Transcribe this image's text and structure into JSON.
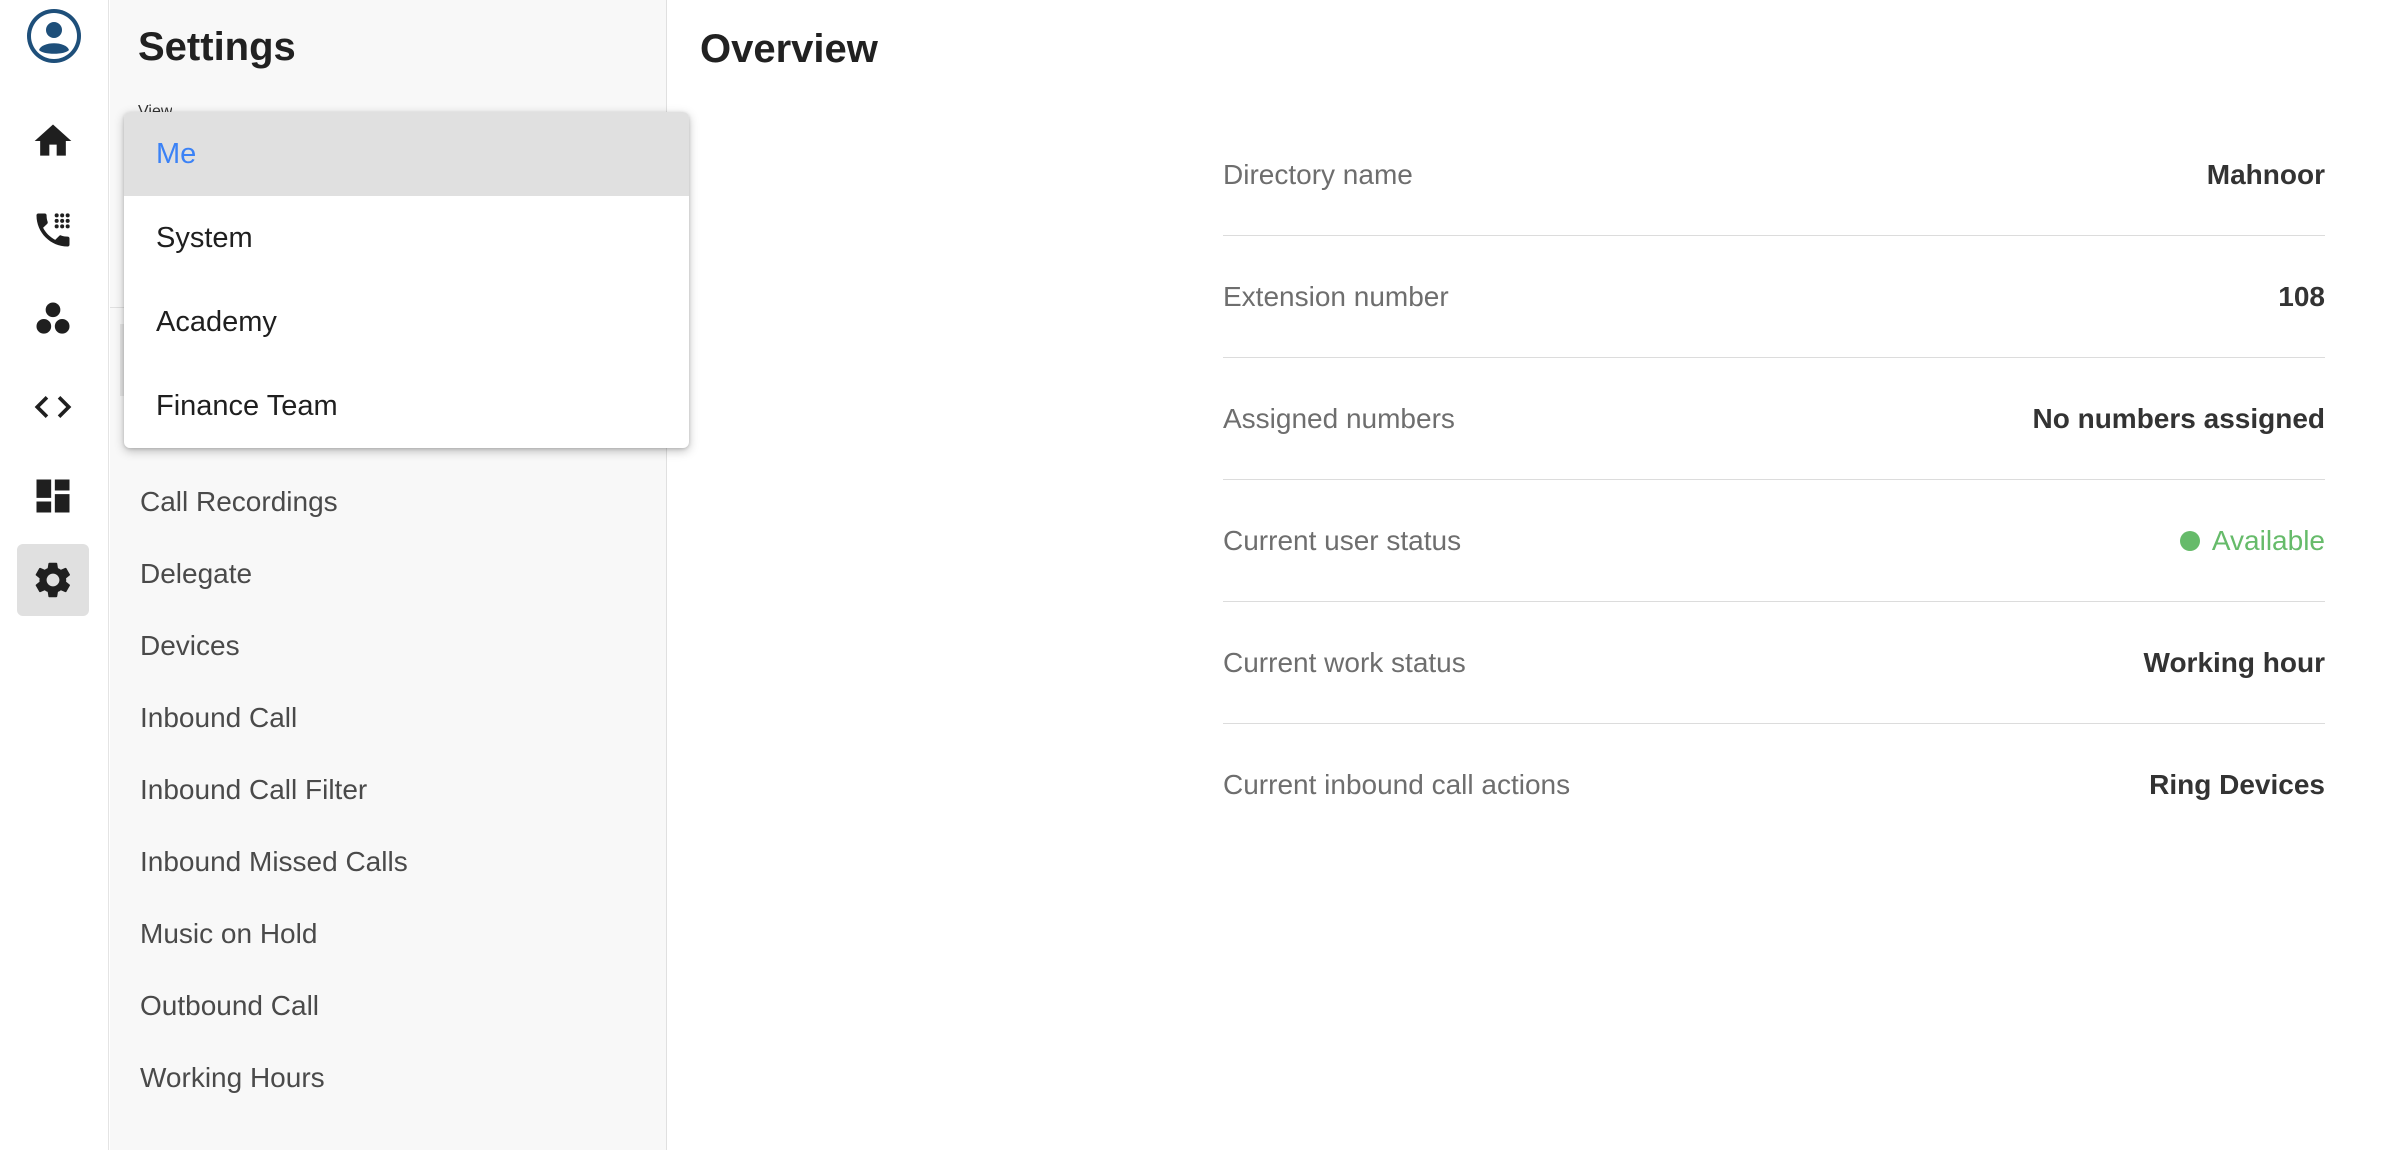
{
  "sidebar": {
    "title": "Settings",
    "view_label": "View",
    "items": [
      {
        "label": "Call Recordings"
      },
      {
        "label": "Delegate"
      },
      {
        "label": "Devices"
      },
      {
        "label": "Inbound Call"
      },
      {
        "label": "Inbound Call Filter"
      },
      {
        "label": "Inbound Missed Calls"
      },
      {
        "label": "Music on Hold"
      },
      {
        "label": "Outbound Call"
      },
      {
        "label": "Working Hours"
      }
    ]
  },
  "dropdown": {
    "selected": "Me",
    "options": [
      {
        "label": "Me"
      },
      {
        "label": "System"
      },
      {
        "label": "Academy"
      },
      {
        "label": "Finance Team"
      }
    ]
  },
  "rail": {
    "icons": [
      "avatar-icon",
      "home-icon",
      "phone-icon",
      "team-icon",
      "code-icon",
      "dashboard-icon",
      "gear-icon"
    ],
    "active": "gear-icon"
  },
  "main": {
    "title": "Overview",
    "rows": [
      {
        "label": "Directory name",
        "value": "Mahnoor"
      },
      {
        "label": "Extension number",
        "value": "108"
      },
      {
        "label": "Assigned numbers",
        "value": "No numbers assigned"
      },
      {
        "label": "Current user status",
        "value": "Available"
      },
      {
        "label": "Current work status",
        "value": "Working hour"
      },
      {
        "label": "Current inbound call actions",
        "value": "Ring Devices"
      }
    ]
  },
  "colors": {
    "accent_blue": "#3b82f6",
    "status_green": "#66bb6a",
    "avatar_blue": "#1e4f7a"
  }
}
